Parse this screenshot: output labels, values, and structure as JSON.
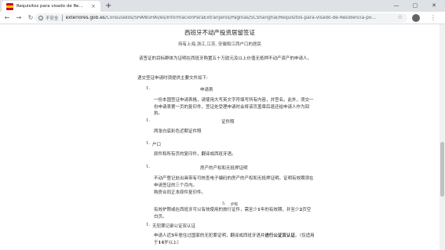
{
  "browser": {
    "tab_title": "Requisitos para visado de Re…",
    "tab_close": "×",
    "new_tab": "+",
    "min": "—",
    "max": "▢",
    "close": "✕",
    "security_label": "不安全",
    "url_domain": "exteriores.gob.es",
    "url_path": "/Consulados/SHANGHAI/es/InformacionParaExtranjeros/Paginas/SCShanghai/Requisitos-para-visado-de-Residencia-po...",
    "nav": {
      "back": "←",
      "forward": "→",
      "reload": "↻"
    },
    "star": "☆",
    "menu": "⋮"
  },
  "page": {
    "title": "西班牙不动产投资居留签证",
    "subtitle": "持有上海,浙江,江苏, 安徽和江西户口的居民",
    "intro": "该签证的目标群体为证明在西班牙购置五十万欧元及以上价值无抵押不动产资产的申请人。",
    "lead": "递交签证申请时须提供主要文件如下:",
    "sections": [
      {
        "num": "1.",
        "heading": "申请表",
        "body": "一份本国签证申请表格，请使用大写英文字符填写所有内容，并签名。此外，须交一份申请表第一页的复印件，签证处受理申请时会将该页盖章后退还给申请人作为回执。"
      },
      {
        "num": "1.",
        "heading": "证件照",
        "body": "两张白底彩色近期证件照"
      },
      {
        "num": "1.",
        "heading": "户口",
        "body": "原件和所有页的复印件，翻译成西班牙语。"
      },
      {
        "num": "1.",
        "heading": "房产的产权和无抵押证明",
        "body": "不动产登记处出具带有可核查电子编码的房产的产权和无抵押证明。证明有效期须在申请签证的三个月内。",
        "body2": "购房合同正本原件复印件。"
      },
      {
        "num": "5.",
        "heading": "护照",
        "body_a": "有效护照或在西班牙可以有效使用的旅行证件，需至少",
        "body_b": "1",
        "body_c": "年的有效期，并至少",
        "body_d": "2",
        "body_e": "页空白页。"
      },
      {
        "num": "1.",
        "heading": "无犯罪记录公证双认证",
        "body_a": "申请人近",
        "body_b": "5",
        "body_c": "年居住过国家的无犯罪证明，翻译成西班牙语并",
        "body_d": "进行公证双认证",
        "body_e": "。（仅适用于",
        "body_f": "14",
        "body_g": "岁以上）"
      }
    ]
  }
}
